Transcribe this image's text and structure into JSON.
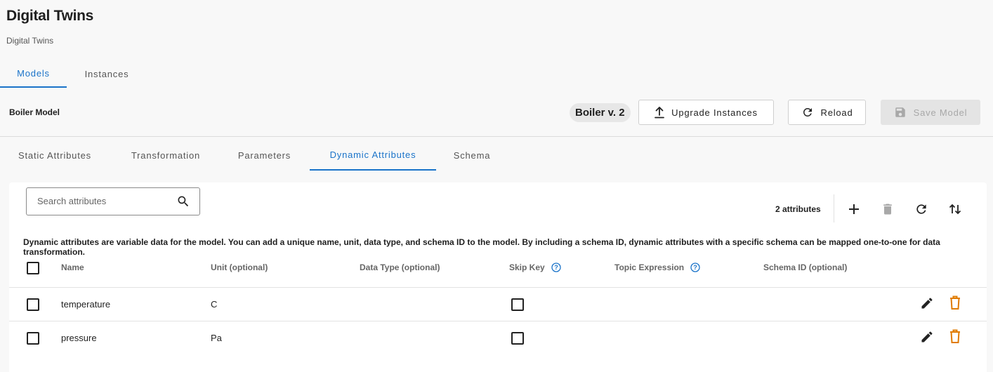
{
  "header": {
    "title": "Digital Twins",
    "breadcrumb": "Digital Twins"
  },
  "main_tabs": [
    {
      "label": "Models",
      "active": true
    },
    {
      "label": "Instances",
      "active": false
    }
  ],
  "model_bar": {
    "model_name": "Boiler Model",
    "version_chip": "Boiler v. 2",
    "upgrade_label": "Upgrade Instances",
    "reload_label": "Reload",
    "save_label": "Save Model"
  },
  "sub_tabs": [
    {
      "label": "Static Attributes",
      "active": false
    },
    {
      "label": "Transformation",
      "active": false
    },
    {
      "label": "Parameters",
      "active": false
    },
    {
      "label": "Dynamic Attributes",
      "active": true
    },
    {
      "label": "Schema",
      "active": false
    }
  ],
  "panel": {
    "search_placeholder": "Search attributes",
    "search_value": "",
    "attribute_count": "2 attributes",
    "description": "Dynamic attributes are variable data for the model. You can add a unique name, unit, data type, and schema ID to the model. By including a schema ID, dynamic attributes with a specific schema can be mapped one-to-one for data transformation."
  },
  "table": {
    "columns": [
      "Name",
      "Unit (optional)",
      "Data Type (optional)",
      "Skip Key",
      "Topic Expression",
      "Schema ID (optional)"
    ],
    "rows": [
      {
        "name": "temperature",
        "unit": "C",
        "data_type": "",
        "skip_key": false,
        "topic_expression": "",
        "schema_id": ""
      },
      {
        "name": "pressure",
        "unit": "Pa",
        "data_type": "",
        "skip_key": false,
        "topic_expression": "",
        "schema_id": ""
      }
    ]
  },
  "icons": {
    "upgrade": "upload-icon",
    "reload": "refresh-icon",
    "save": "save-icon",
    "search": "search-icon",
    "add": "plus-icon",
    "delete": "trash-icon",
    "refresh": "refresh-icon",
    "sort": "sort-icon",
    "help": "help-circle-icon",
    "edit": "pencil-icon"
  },
  "colors": {
    "accent": "#1a73c9",
    "delete": "#e07b00",
    "disabled": "#a8a8a8"
  }
}
